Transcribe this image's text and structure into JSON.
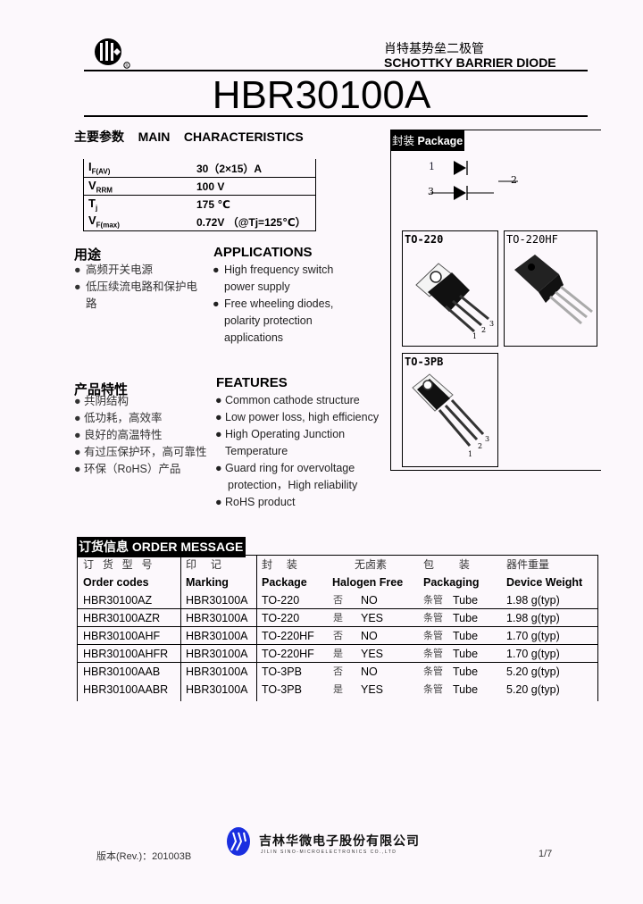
{
  "header": {
    "logo_icon": "company-logo-icon",
    "registered_mark": "®",
    "subtitle_cn": "肖特基势垒二极管",
    "subtitle_en": "SCHOTTKY BARRIER DIODE",
    "part_number": "HBR30100A"
  },
  "main_characteristics": {
    "heading_cn": "主要参数",
    "heading_en": "MAIN    CHARACTERISTICS",
    "rows": [
      {
        "symbol": "I",
        "sub": "F(AV)",
        "value": "30（2×15）A"
      },
      {
        "symbol": "V",
        "sub": "RRM",
        "value": "100 V"
      },
      {
        "symbol": "T",
        "sub": "j",
        "value": "175 ℃"
      },
      {
        "symbol": "V",
        "sub": "F(max)",
        "value": "0.72V  （@Tj=125℃）"
      }
    ]
  },
  "applications": {
    "heading_cn": "用途",
    "heading_en": "APPLICATIONS",
    "items_cn": [
      {
        "line1": "高频开关电源",
        "line2": ""
      },
      {
        "line1": "低压续流电路和保护电",
        "line2": "路"
      }
    ],
    "items_en": [
      {
        "line1": "High frequency switch",
        "line2": "power supply",
        "line3": ""
      },
      {
        "line1": "Free wheeling diodes,",
        "line2": "polarity protection",
        "line3": "applications"
      }
    ]
  },
  "features": {
    "heading_cn": "产品特性",
    "heading_en": "FEATURES",
    "items_cn": [
      "共阴结构",
      "低功耗，高效率",
      "良好的高温特性",
      "有过压保护环，高可靠性",
      "环保（RoHS）产品"
    ],
    "items_en": [
      {
        "line1": "Common cathode structure",
        "line2": ""
      },
      {
        "line1": "Low power loss, high efficiency",
        "line2": ""
      },
      {
        "line1": "High Operating Junction",
        "line2": "Temperature"
      },
      {
        "line1": "Guard ring for overvoltage",
        "line2": "protection，High reliability"
      },
      {
        "line1": "RoHS product",
        "line2": ""
      }
    ],
    "bullet": "●"
  },
  "package": {
    "label_cn": "封装",
    "label_en": "Package",
    "pins": {
      "p1": "1",
      "p2": "2",
      "p3": "3"
    },
    "cards": [
      {
        "name": "TO-220"
      },
      {
        "name": "TO-220HF"
      },
      {
        "name": "TO-3PB"
      }
    ]
  },
  "order": {
    "heading_cn": "订货信息",
    "heading_en": "ORDER MESSAGE",
    "columns_cn": [
      "订 货 型 号",
      "印　 记",
      "封　 装",
      "无卤素",
      "包　　 装",
      "器件重量"
    ],
    "columns_en": [
      "Order codes",
      "Marking",
      "Package",
      "Halogen Free",
      "Packaging",
      "Device Weight"
    ],
    "rows": [
      {
        "code": "HBR30100AZ",
        "marking": "HBR30100A",
        "package": "TO-220",
        "hf_cn": "否",
        "hf": "NO",
        "pack_cn": "条管",
        "pack": "Tube",
        "weight": "1.98 g(typ)"
      },
      {
        "code": "HBR30100AZR",
        "marking": "HBR30100A",
        "package": "TO-220",
        "hf_cn": "是",
        "hf": "YES",
        "pack_cn": "条管",
        "pack": "Tube",
        "weight": "1.98 g(typ)"
      },
      {
        "code": "HBR30100AHF",
        "marking": "HBR30100A",
        "package": "TO-220HF",
        "hf_cn": "否",
        "hf": "NO",
        "pack_cn": "条管",
        "pack": "Tube",
        "weight": "1.70 g(typ)"
      },
      {
        "code": "HBR30100AHFR",
        "marking": "HBR30100A",
        "package": "TO-220HF",
        "hf_cn": "是",
        "hf": "YES",
        "pack_cn": "条管",
        "pack": "Tube",
        "weight": "1.70 g(typ)"
      },
      {
        "code": "HBR30100AAB",
        "marking": "HBR30100A",
        "package": "TO-3PB",
        "hf_cn": "否",
        "hf": "NO",
        "pack_cn": "条管",
        "pack": "Tube",
        "weight": "5.20 g(typ)"
      },
      {
        "code": "HBR30100AABR",
        "marking": "HBR30100A",
        "package": "TO-3PB",
        "hf_cn": "是",
        "hf": "YES",
        "pack_cn": "条管",
        "pack": "Tube",
        "weight": "5.20 g(typ)"
      }
    ]
  },
  "footer": {
    "revision": "版本(Rev.)：201003B",
    "company_cn": "吉林华微电子股份有限公司",
    "company_en": "JILIN  SINO-MICROELECTRONICS  CO.,LTD",
    "page": "1/7",
    "logo_color": "#1a2fe0"
  }
}
